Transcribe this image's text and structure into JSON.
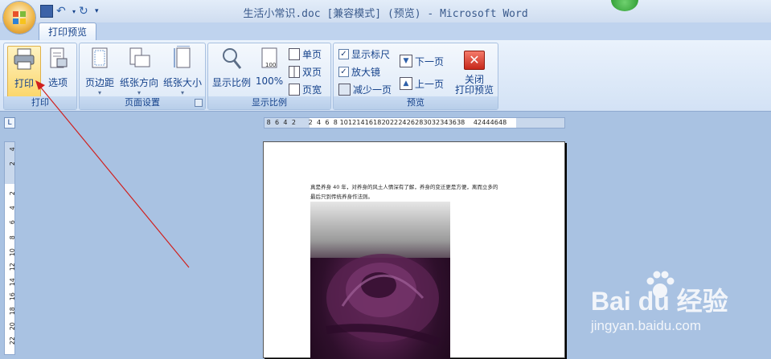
{
  "window": {
    "title": "生活小常识.doc [兼容模式] (预览) - Microsoft Word"
  },
  "ribbon": {
    "active_tab": "打印预览",
    "groups": [
      {
        "label": "打印",
        "buttons": [
          "打印",
          "选项"
        ]
      },
      {
        "label": "页面设置",
        "buttons": [
          "页边距",
          "纸张方向",
          "纸张大小"
        ]
      },
      {
        "label": "显示比例",
        "buttons": [
          "显示比例",
          "100%",
          "单页",
          "双页",
          "页宽"
        ]
      },
      {
        "label": "预览",
        "checkboxes": [
          {
            "label": "显示标尺",
            "checked": true
          },
          {
            "label": "放大镜",
            "checked": true
          }
        ],
        "buttons": [
          "减少一页",
          "下一页",
          "上一页",
          "关闭\n打印预览"
        ]
      }
    ]
  },
  "ruler": {
    "h_ticks": [
      "8",
      "6",
      "4",
      "2",
      "",
      "2",
      "4",
      "6",
      "8",
      "10",
      "12",
      "14",
      "16",
      "18",
      "20",
      "22",
      "24",
      "26",
      "28",
      "30",
      "32",
      "34",
      "36",
      "38",
      "",
      "42",
      "44",
      "46",
      "48"
    ],
    "v_ticks": [
      "4",
      "2",
      "",
      "2",
      "4",
      "6",
      "8",
      "10",
      "12",
      "14",
      "16",
      "18",
      "20",
      "22"
    ]
  },
  "page": {
    "line1": "真是养身 40 年，对养身的风土人情深有了解，养身的变迁更是方便，离而立多的",
    "line2": "最后只到传统养身作法则。"
  },
  "watermark": {
    "brand": "Bai du 经验",
    "url": "jingyan.baidu.com"
  },
  "colors": {
    "ribbon_text": "#15428b",
    "arrow": "#d0201e"
  }
}
